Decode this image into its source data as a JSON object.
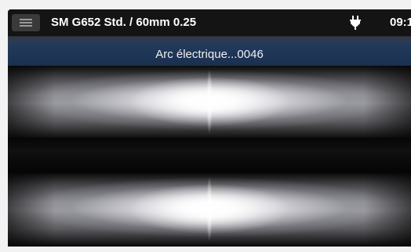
{
  "header": {
    "title": "SM G652 Std. / 60mm 0.25",
    "time": "09:1"
  },
  "icons": {
    "menu": "hamburger-menu-icon",
    "power": "power-plug-icon"
  },
  "colors": {
    "topbar": "#141414",
    "status_bar": "#1a3050",
    "text": "#ffffff"
  },
  "camera": {
    "status_text": "Arc électrique...0046"
  }
}
